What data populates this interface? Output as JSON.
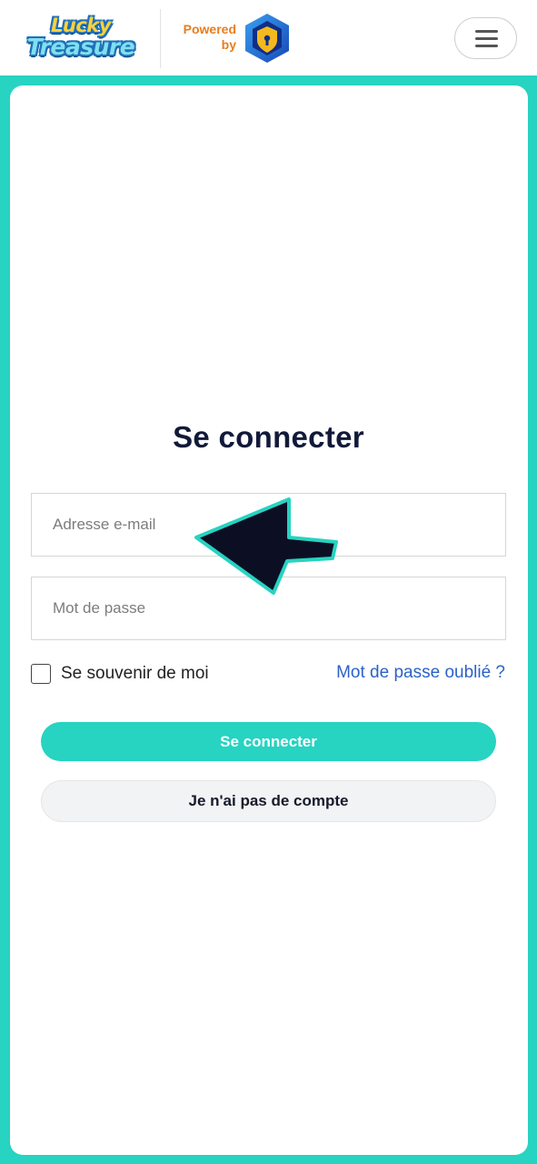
{
  "header": {
    "logo_line1": "Lucky",
    "logo_line2": "Treasure",
    "powered_line1": "Powered",
    "powered_line2": "by",
    "menu_icon": "hamburger-menu-icon",
    "shield_icon": "shield-lock-icon"
  },
  "login": {
    "title": "Se connecter",
    "email_placeholder": "Adresse e-mail",
    "password_placeholder": "Mot de passe",
    "remember_label": "Se souvenir de moi",
    "forgot_link": "Mot de passe oublié ?",
    "submit_label": "Se connecter",
    "no_account_label": "Je n'ai pas de compte"
  },
  "colors": {
    "accent": "#27d3c1",
    "link": "#2b62c8",
    "title": "#121a3a",
    "powered": "#e87d1e"
  }
}
